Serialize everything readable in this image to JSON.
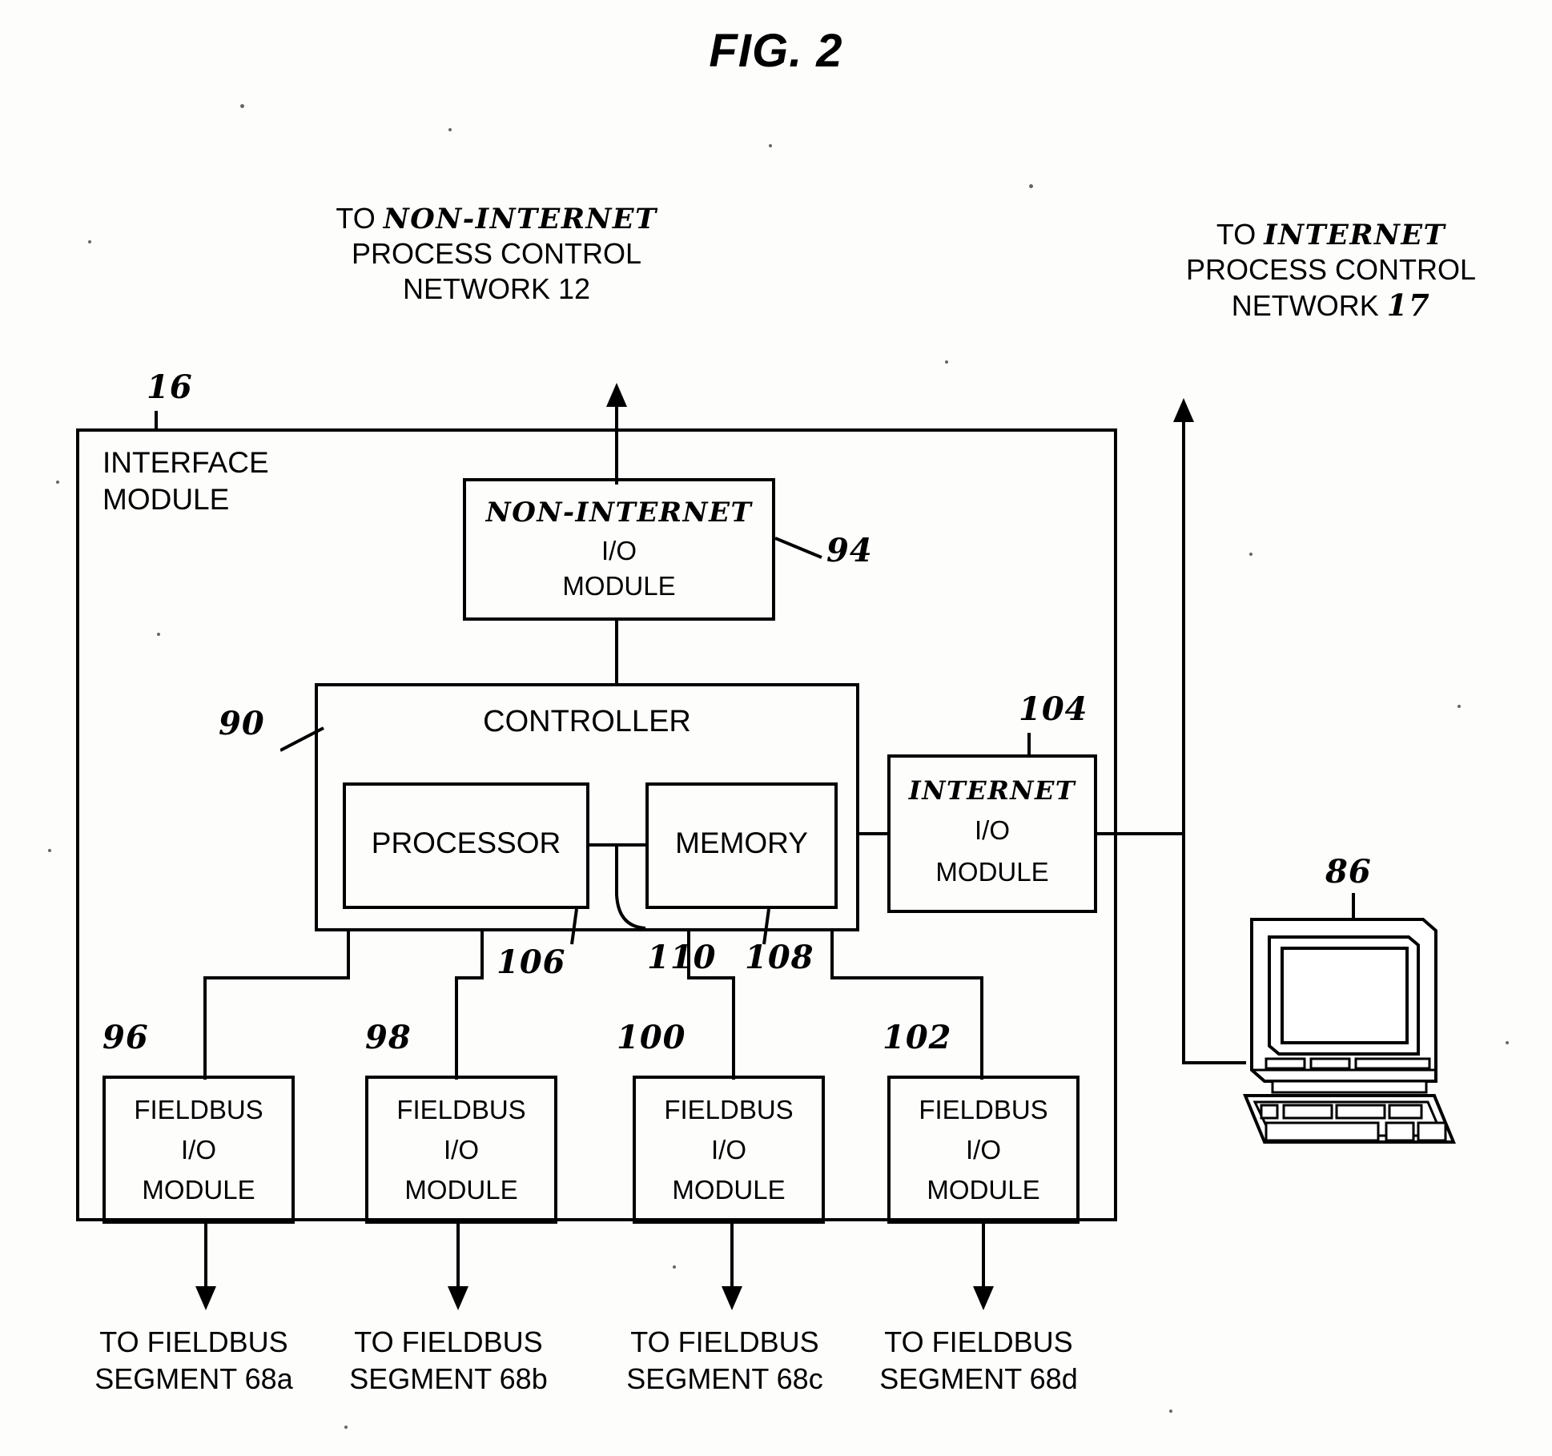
{
  "figure": {
    "title": "FIG. 2",
    "type": "patent-block-diagram"
  },
  "labels": {
    "non_internet_network": {
      "line1_prefix": "TO",
      "line1_hand": "NON-INTERNET",
      "line2": "PROCESS CONTROL",
      "line3": "NETWORK 12"
    },
    "internet_network": {
      "line1_prefix": "TO",
      "line1_hand": "INTERNET",
      "line2": "PROCESS CONTROL",
      "line3_prefix": "NETWORK",
      "line3_hand": "17"
    },
    "interface_module": {
      "line1": "INTERFACE",
      "line2": "MODULE"
    }
  },
  "reference_numerals": {
    "interface_module": "16",
    "non_internet_io": "94",
    "controller": "90",
    "internet_io": "104",
    "processor": "106",
    "bus": "110",
    "memory": "108",
    "fieldbus_a": "96",
    "fieldbus_b": "98",
    "fieldbus_c": "100",
    "fieldbus_d": "102",
    "workstation": "86"
  },
  "blocks": {
    "non_internet_io": {
      "line1_hand": "NON-INTERNET",
      "line2": "I/O",
      "line3": "MODULE"
    },
    "controller": {
      "title": "CONTROLLER"
    },
    "processor": {
      "title": "PROCESSOR"
    },
    "memory": {
      "title": "MEMORY"
    },
    "internet_io": {
      "line1_hand": "INTERNET",
      "line2": "I/O",
      "line3": "MODULE"
    },
    "fieldbus_modules": [
      {
        "line1": "FIELDBUS",
        "line2": "I/O",
        "line3": "MODULE"
      },
      {
        "line1": "FIELDBUS",
        "line2": "I/O",
        "line3": "MODULE"
      },
      {
        "line1": "FIELDBUS",
        "line2": "I/O",
        "line3": "MODULE"
      },
      {
        "line1": "FIELDBUS",
        "line2": "I/O",
        "line3": "MODULE"
      }
    ]
  },
  "fieldbus_destinations": [
    {
      "line1": "TO FIELDBUS",
      "line2": "SEGMENT 68a"
    },
    {
      "line1": "TO FIELDBUS",
      "line2": "SEGMENT 68b"
    },
    {
      "line1": "TO FIELDBUS",
      "line2": "SEGMENT 68c"
    },
    {
      "line1": "TO FIELDBUS",
      "line2": "SEGMENT 68d"
    }
  ],
  "workstation": {
    "icon": "computer-workstation-icon"
  },
  "colors": {
    "ink": "#000000",
    "paper": "#fdfdfc"
  }
}
